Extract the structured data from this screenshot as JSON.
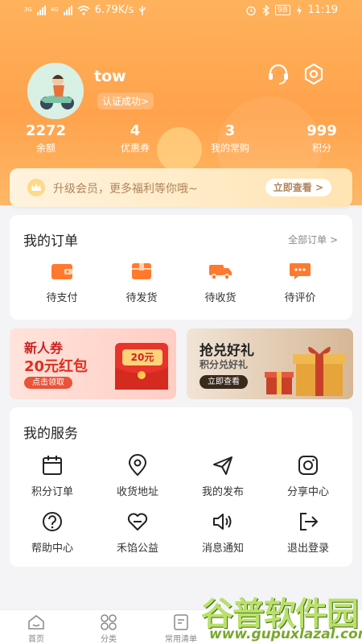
{
  "status_bar": {
    "signal1": "3G",
    "signal2": "4G",
    "network_speed": "6.79K/s",
    "battery": "98",
    "time": "11:19"
  },
  "profile": {
    "username": "tow",
    "verify_label": "认证成功>",
    "stats": [
      {
        "value": "2272",
        "label": "余额"
      },
      {
        "value": "4",
        "label": "优惠券"
      },
      {
        "value": "3",
        "label": "我的常购"
      },
      {
        "value": "999",
        "label": "积分"
      }
    ]
  },
  "vip_banner": {
    "text": "升级会员，更多福利等你哦~",
    "button": "立即查看 >"
  },
  "orders": {
    "title": "我的订单",
    "all_link": "全部订单 >",
    "items": [
      {
        "label": "待支付",
        "icon": "wallet-icon"
      },
      {
        "label": "待发货",
        "icon": "box-icon"
      },
      {
        "label": "待收货",
        "icon": "truck-icon"
      },
      {
        "label": "待评价",
        "icon": "comment-icon"
      }
    ]
  },
  "promo_left": {
    "title": "新人券",
    "subtitle": "20元红包",
    "button": "点击领取",
    "tag": "20元"
  },
  "promo_right": {
    "title": "抢兑好礼",
    "subtitle": "积分兑好礼",
    "button": "立即查看"
  },
  "services": {
    "title": "我的服务",
    "items": [
      {
        "label": "积分订单",
        "icon": "calendar-icon"
      },
      {
        "label": "收货地址",
        "icon": "location-icon"
      },
      {
        "label": "我的发布",
        "icon": "send-icon"
      },
      {
        "label": "分享中心",
        "icon": "share-icon"
      },
      {
        "label": "帮助中心",
        "icon": "help-icon"
      },
      {
        "label": "禾馅公益",
        "icon": "heart-icon"
      },
      {
        "label": "消息通知",
        "icon": "speaker-icon"
      },
      {
        "label": "退出登录",
        "icon": "logout-icon"
      }
    ]
  },
  "tab_bar": {
    "items": [
      {
        "label": "首页",
        "icon": "home-icon"
      },
      {
        "label": "分类",
        "icon": "category-icon"
      },
      {
        "label": "常用清单",
        "icon": "list-icon"
      }
    ]
  },
  "watermark": {
    "line1": "谷普软件园",
    "line2": "www.gupuxlazal.com"
  },
  "colors": {
    "header_orange": "#ffa24c",
    "accent_orange": "#ff7a2e",
    "vip_text": "#b0845a"
  }
}
